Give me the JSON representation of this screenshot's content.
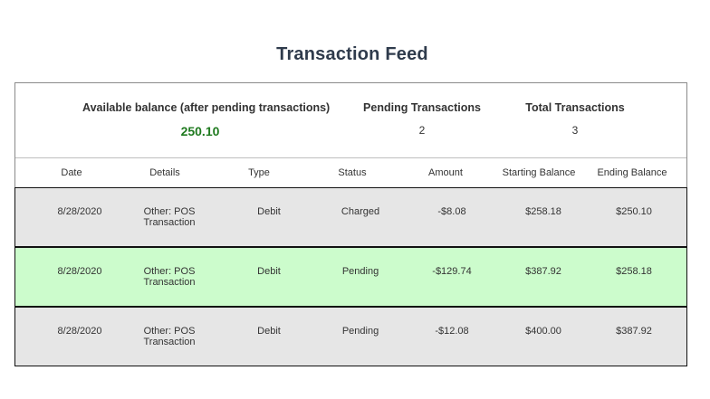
{
  "page": {
    "title": "Transaction Feed"
  },
  "summary": {
    "balance_label": "Available balance (after pending transactions)",
    "balance_value": "250.10",
    "pending_label": "Pending Transactions",
    "pending_value": "2",
    "total_label": "Total Transactions",
    "total_value": "3"
  },
  "table": {
    "columns": [
      "Date",
      "Details",
      "Type",
      "Status",
      "Amount",
      "Starting Balance",
      "Ending Balance"
    ],
    "rows": [
      {
        "date": "8/28/2020",
        "details_line1": "Other: POS",
        "details_line2": "Transaction",
        "type": "Debit",
        "status": "Charged",
        "amount": "-$8.08",
        "starting_balance": "$258.18",
        "ending_balance": "$250.10",
        "row_color": "#e6e6e6"
      },
      {
        "date": "8/28/2020",
        "details_line1": "Other: POS",
        "details_line2": "Transaction",
        "type": "Debit",
        "status": "Pending",
        "amount": "-$129.74",
        "starting_balance": "$387.92",
        "ending_balance": "$258.18",
        "row_color": "#ccfccc"
      },
      {
        "date": "8/28/2020",
        "details_line1": "Other: POS",
        "details_line2": "Transaction",
        "type": "Debit",
        "status": "Pending",
        "amount": "-$12.08",
        "starting_balance": "$400.00",
        "ending_balance": "$387.92",
        "row_color": "#e6e6e6"
      }
    ]
  },
  "colors": {
    "title": "#2f3b4c",
    "balance_value": "#1f7a1f",
    "row_gray": "#e6e6e6",
    "row_green": "#ccfccc"
  }
}
